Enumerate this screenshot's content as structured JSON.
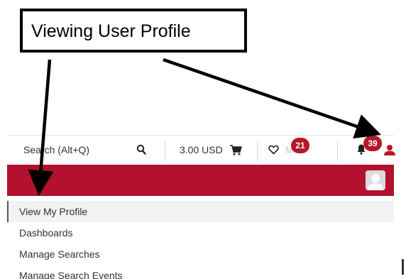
{
  "callout": {
    "text": "Viewing User Profile"
  },
  "toolbar": {
    "search_placeholder": "Search (Alt+Q)",
    "cart_total": "3.00 USD",
    "favorites_count": "21",
    "notifications_count": "39",
    "faded_label": "M"
  },
  "menu": {
    "items": [
      {
        "label": "View My Profile",
        "active": true
      },
      {
        "label": "Dashboards"
      },
      {
        "label": "Manage Searches"
      },
      {
        "label": "Manage Search Events"
      }
    ]
  },
  "colors": {
    "banner": "#b3112e",
    "badge": "#b5172b"
  },
  "icons": [
    "search-icon",
    "cart-icon",
    "heart-icon",
    "bell-icon",
    "user-icon",
    "avatar-icon"
  ]
}
